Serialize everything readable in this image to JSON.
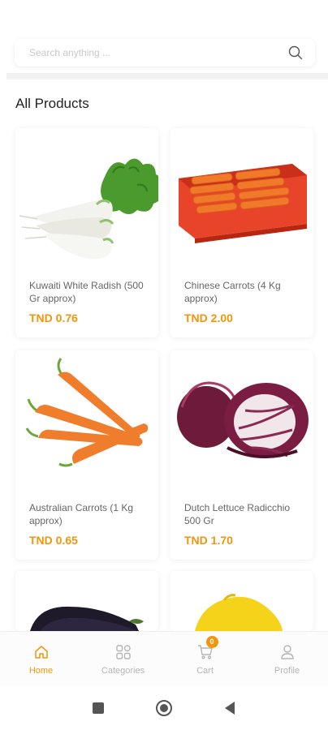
{
  "search": {
    "placeholder": "Search anything ..."
  },
  "section_title": "All Products",
  "products": [
    {
      "name": "Kuwaiti White Radish (500 Gr approx)",
      "price": "TND 0.76"
    },
    {
      "name": "Chinese Carrots (4 Kg approx)",
      "price": "TND 2.00"
    },
    {
      "name": "Australian Carrots (1 Kg approx)",
      "price": "TND 0.65"
    },
    {
      "name": "Dutch Lettuce Radicchio 500 Gr",
      "price": "TND 1.70"
    }
  ],
  "bottom_nav": {
    "items": [
      {
        "label": "Home",
        "icon": "home-icon"
      },
      {
        "label": "Categories",
        "icon": "categories-icon"
      },
      {
        "label": "Cart",
        "icon": "cart-icon",
        "badge": "0"
      },
      {
        "label": "Profile",
        "icon": "profile-icon"
      }
    ],
    "active_color": "#f0960a",
    "inactive_color": "#b5b5b5"
  },
  "accent_color": "#f0960a"
}
